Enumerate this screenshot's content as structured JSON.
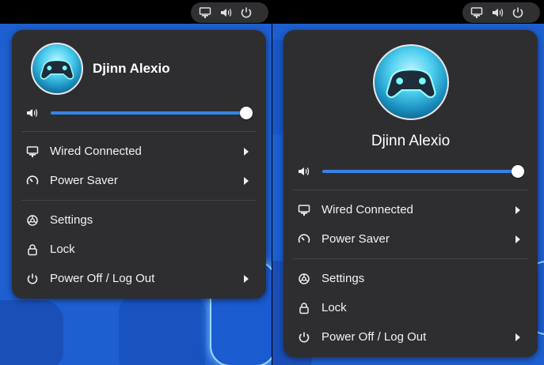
{
  "colors": {
    "topbar": "#000000",
    "wallpaper": "#1d5fd0",
    "menu_bg": "#2e2e30",
    "accent": "#3584e4",
    "text": "#f2f2f2"
  },
  "status_area": {
    "icons": [
      "wired-network-icon",
      "speaker-icon",
      "power-icon"
    ]
  },
  "user": {
    "name": "Djinn Alexio",
    "avatar_icon": "gamepad-icon"
  },
  "volume": {
    "icon": "speaker-icon",
    "level_percent": 100
  },
  "menu": {
    "wired_label": "Wired Connected",
    "power_mode_label": "Power Saver",
    "settings_label": "Settings",
    "lock_label": "Lock",
    "power_off_label": "Power Off / Log Out"
  }
}
